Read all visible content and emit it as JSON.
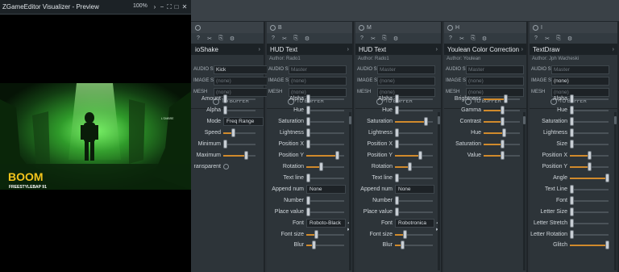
{
  "preview": {
    "title": "ZGameEditor Visualizer - Preview",
    "zoom": "100%",
    "controls": [
      "›",
      "−",
      "⛶",
      "□",
      "✕"
    ],
    "image_text": {
      "line1": "L'OMBRE",
      "title": "BOOM",
      "subtitle": "FREESTYLEBAP 91"
    }
  },
  "labels": {
    "audio_src": "AUDIO SRC",
    "image_src": "IMAGE SRC",
    "mesh": "MESH",
    "to_buffer": "TO BUFFER"
  },
  "icons": [
    "?",
    "✂",
    "⎘",
    "⚙"
  ],
  "colors": {
    "accent": "#d08a2c",
    "panel": "#2d3439",
    "header": "#1c2226"
  },
  "panels": [
    {
      "id": "audioshake",
      "tab": "",
      "name": "ioShake",
      "author": "",
      "audio_src": "Kick",
      "image_src": "(none)",
      "mesh": "(none)",
      "params": [
        {
          "label": "Amount",
          "type": "slider",
          "value": 0.05
        },
        {
          "label": "Alpha",
          "type": "slider",
          "value": 0.05
        },
        {
          "label": "Mode",
          "type": "select",
          "value": "Freq Range"
        },
        {
          "label": "Speed",
          "type": "slider",
          "value": 0.3
        },
        {
          "label": "Minimum",
          "type": "slider",
          "value": 0.05
        },
        {
          "label": "Maximum",
          "type": "slider",
          "value": 0.7
        },
        {
          "label": "ransparent",
          "type": "radio"
        }
      ]
    },
    {
      "id": "hudtext1",
      "tab": "B",
      "name": "HUD Text",
      "author": "Author: Rado1",
      "audio_src": "Master",
      "image_src": "(none)",
      "mesh": "(none)",
      "params": [
        {
          "label": "Alpha",
          "type": "slider",
          "value": 0.05
        },
        {
          "label": "Hue",
          "type": "slider",
          "value": 0.05
        },
        {
          "label": "Saturation",
          "type": "slider",
          "value": 0.05
        },
        {
          "label": "Lightness",
          "type": "slider",
          "value": 0.05
        },
        {
          "label": "Position X",
          "type": "slider",
          "value": 0.05
        },
        {
          "label": "Position Y",
          "type": "slider",
          "value": 0.8
        },
        {
          "label": "Rotation",
          "type": "slider",
          "value": 0.38
        },
        {
          "label": "Text line",
          "type": "slider",
          "value": 0.05
        },
        {
          "label": "Append num",
          "type": "select",
          "value": "None"
        },
        {
          "label": "Number",
          "type": "slider",
          "value": 0.05
        },
        {
          "label": "Place value",
          "type": "slider",
          "value": 0.05
        },
        {
          "label": "Font",
          "type": "font",
          "value": "Roboto-Black"
        },
        {
          "label": "Font size",
          "type": "slider",
          "value": 0.25
        },
        {
          "label": "Blur",
          "type": "slider",
          "value": 0.2
        }
      ]
    },
    {
      "id": "hudtext2",
      "tab": "M",
      "name": "HUD Text",
      "author": "Author: Rado1",
      "audio_src": "Master",
      "image_src": "(none)",
      "mesh": "(none)",
      "params": [
        {
          "label": "Alpha",
          "type": "slider",
          "value": 0.05
        },
        {
          "label": "Hue",
          "type": "slider",
          "value": 0.05
        },
        {
          "label": "Saturation",
          "type": "slider",
          "value": 0.8
        },
        {
          "label": "Lightness",
          "type": "slider",
          "value": 0.05
        },
        {
          "label": "Position X",
          "type": "slider",
          "value": 0.05
        },
        {
          "label": "Position Y",
          "type": "slider",
          "value": 0.65
        },
        {
          "label": "Rotation",
          "type": "slider",
          "value": 0.38
        },
        {
          "label": "Text line",
          "type": "slider",
          "value": 0.05
        },
        {
          "label": "Append num",
          "type": "select",
          "value": "None"
        },
        {
          "label": "Number",
          "type": "slider",
          "value": 0.05
        },
        {
          "label": "Place value",
          "type": "slider",
          "value": 0.05
        },
        {
          "label": "Font",
          "type": "font",
          "value": "Robotronica"
        },
        {
          "label": "Font size",
          "type": "slider",
          "value": 0.25
        },
        {
          "label": "Blur",
          "type": "slider",
          "value": 0.2
        }
      ]
    },
    {
      "id": "youlean",
      "tab": "H",
      "name": "Youlean Color Correction",
      "author": "Author: Youlean",
      "audio_src": "Master",
      "image_src": "(none)",
      "mesh": "(none)",
      "params": [
        {
          "label": "Brightness",
          "type": "slider",
          "value": 0.6
        },
        {
          "label": "Gamma",
          "type": "slider",
          "value": 0.5
        },
        {
          "label": "Contrast",
          "type": "slider",
          "value": 0.5
        },
        {
          "label": "Hue",
          "type": "slider",
          "value": 0.55
        },
        {
          "label": "Saturation",
          "type": "slider",
          "value": 0.5
        },
        {
          "label": "Value",
          "type": "slider",
          "value": 0.5
        }
      ]
    },
    {
      "id": "textdraw",
      "tab": "I",
      "name": "TextDraw",
      "author": "Author: Jph Wacheski",
      "audio_src": "Master",
      "image_src": "(none)",
      "mesh": "(none)",
      "params": [
        {
          "label": "Alpha",
          "type": "slider",
          "value": 0.05
        },
        {
          "label": "Hue",
          "type": "slider",
          "value": 0.05
        },
        {
          "label": "Saturation",
          "type": "slider",
          "value": 0.05
        },
        {
          "label": "Lightness",
          "type": "slider",
          "value": 0.05
        },
        {
          "label": "Size",
          "type": "slider",
          "value": 0.05
        },
        {
          "label": "Position X",
          "type": "slider",
          "value": 0.5
        },
        {
          "label": "Position Y",
          "type": "slider",
          "value": 0.5
        },
        {
          "label": "Angle",
          "type": "slider",
          "value": 0.95
        },
        {
          "label": "Text Line",
          "type": "slider",
          "value": 0.05
        },
        {
          "label": "Font",
          "type": "slider",
          "value": 0.05
        },
        {
          "label": "Letter Size",
          "type": "slider",
          "value": 0.05
        },
        {
          "label": "Letter Stretch",
          "type": "slider",
          "value": 0.05
        },
        {
          "label": "Letter Rotation",
          "type": "slider",
          "value": 0.05
        },
        {
          "label": "Glitch",
          "type": "slider",
          "value": 0.95
        }
      ]
    }
  ]
}
